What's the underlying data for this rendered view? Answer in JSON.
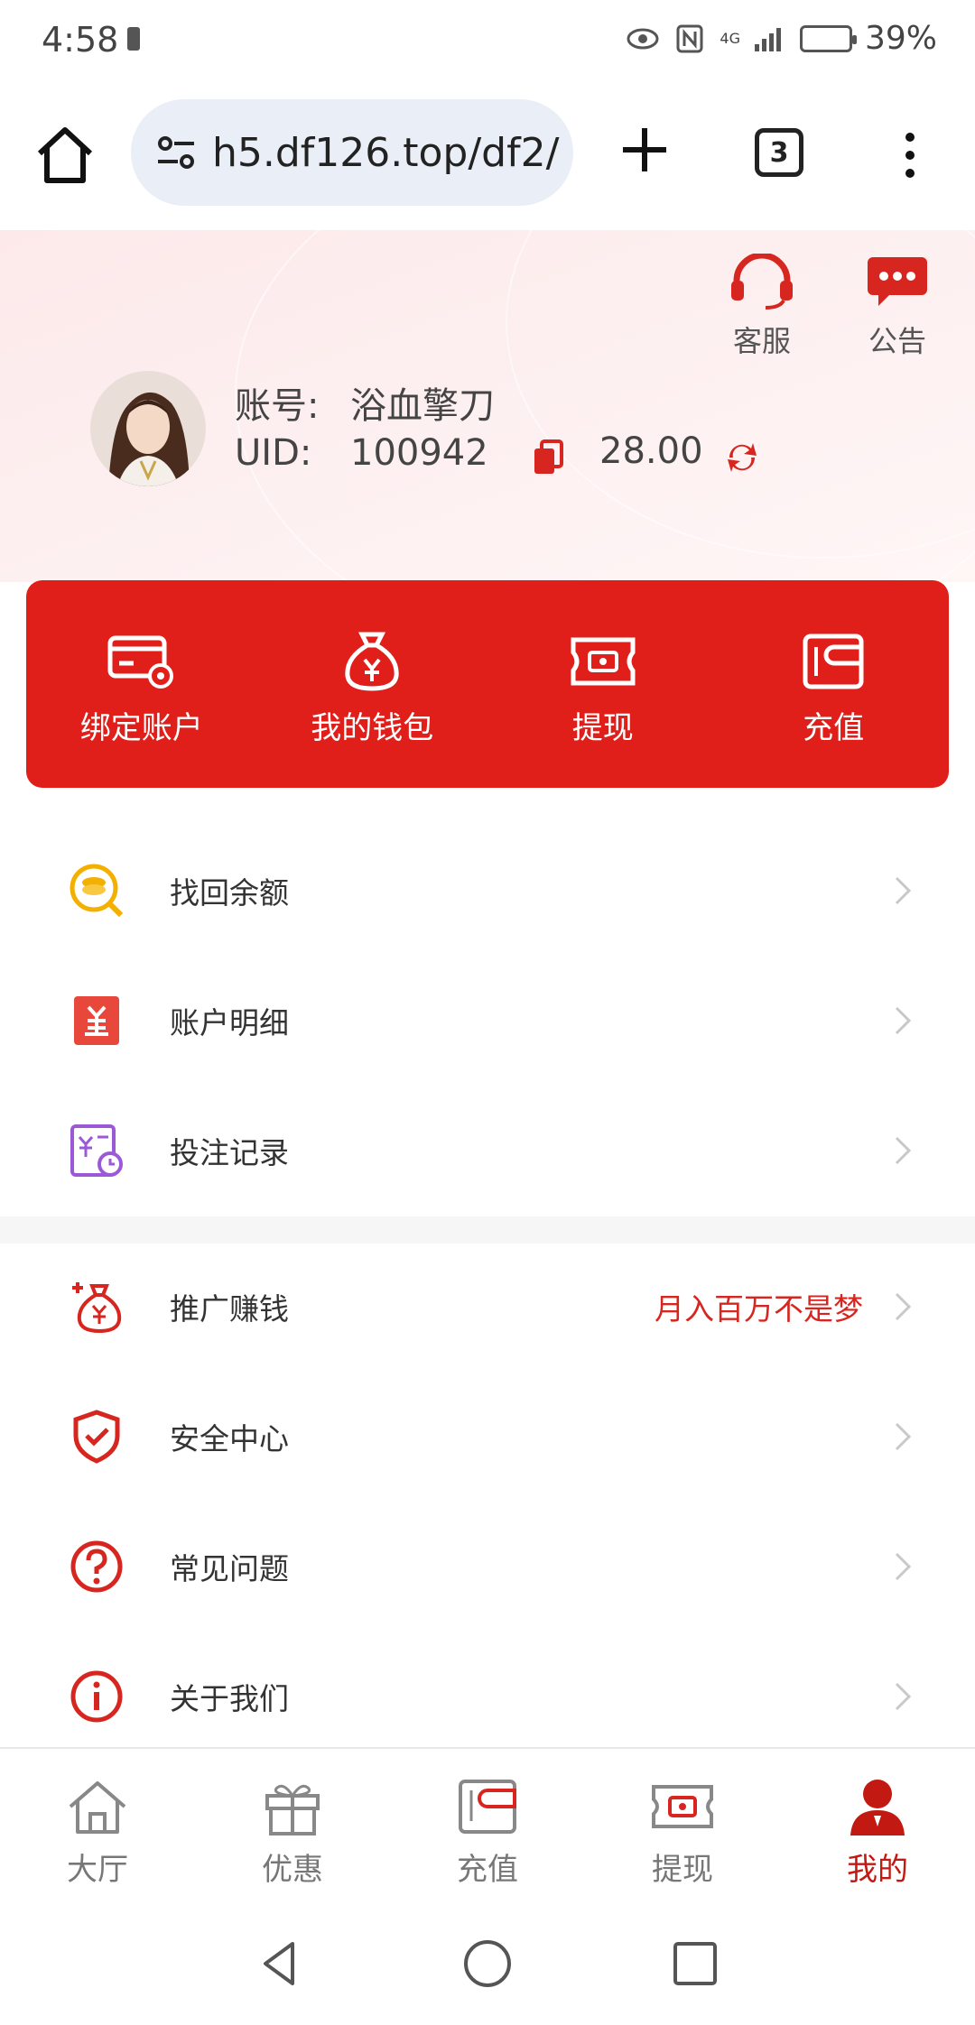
{
  "status_bar": {
    "time": "4:58",
    "signal": "4G",
    "battery": "39%"
  },
  "browser": {
    "url": "h5.df126.top/df2/",
    "tab_count": "3"
  },
  "profile": {
    "service_label": "客服",
    "notice_label": "公告",
    "account_key": "账号:",
    "account_value": "浴血擎刀",
    "uid_key": "UID:",
    "uid_value": "100942",
    "balance": "28.00"
  },
  "quick_actions": [
    {
      "label": "绑定账户",
      "icon": "card-settings-icon"
    },
    {
      "label": "我的钱包",
      "icon": "money-bag-icon"
    },
    {
      "label": "提现",
      "icon": "withdraw-ticket-icon"
    },
    {
      "label": "充值",
      "icon": "wallet-icon"
    }
  ],
  "menu_group_1": [
    {
      "label": "找回余额",
      "icon": "coin-search-icon"
    },
    {
      "label": "账户明细",
      "icon": "yuan-document-icon"
    },
    {
      "label": "投注记录",
      "icon": "bet-record-icon"
    }
  ],
  "menu_group_2": [
    {
      "label": "推广赚钱",
      "icon": "plus-money-bag-icon",
      "extra": "月入百万不是梦"
    },
    {
      "label": "安全中心",
      "icon": "shield-check-icon"
    },
    {
      "label": "常见问题",
      "icon": "question-circle-icon"
    },
    {
      "label": "关于我们",
      "icon": "info-circle-icon"
    }
  ],
  "tab_bar": [
    {
      "label": "大厅",
      "icon": "home-icon"
    },
    {
      "label": "优惠",
      "icon": "gift-icon"
    },
    {
      "label": "充值",
      "icon": "wallet-icon"
    },
    {
      "label": "提现",
      "icon": "withdraw-ticket-icon"
    },
    {
      "label": "我的",
      "icon": "user-icon",
      "active": true
    }
  ],
  "colors": {
    "brand_red": "#e01e1a",
    "active_tab": "#c21a12",
    "promo_text": "#d7261f"
  }
}
